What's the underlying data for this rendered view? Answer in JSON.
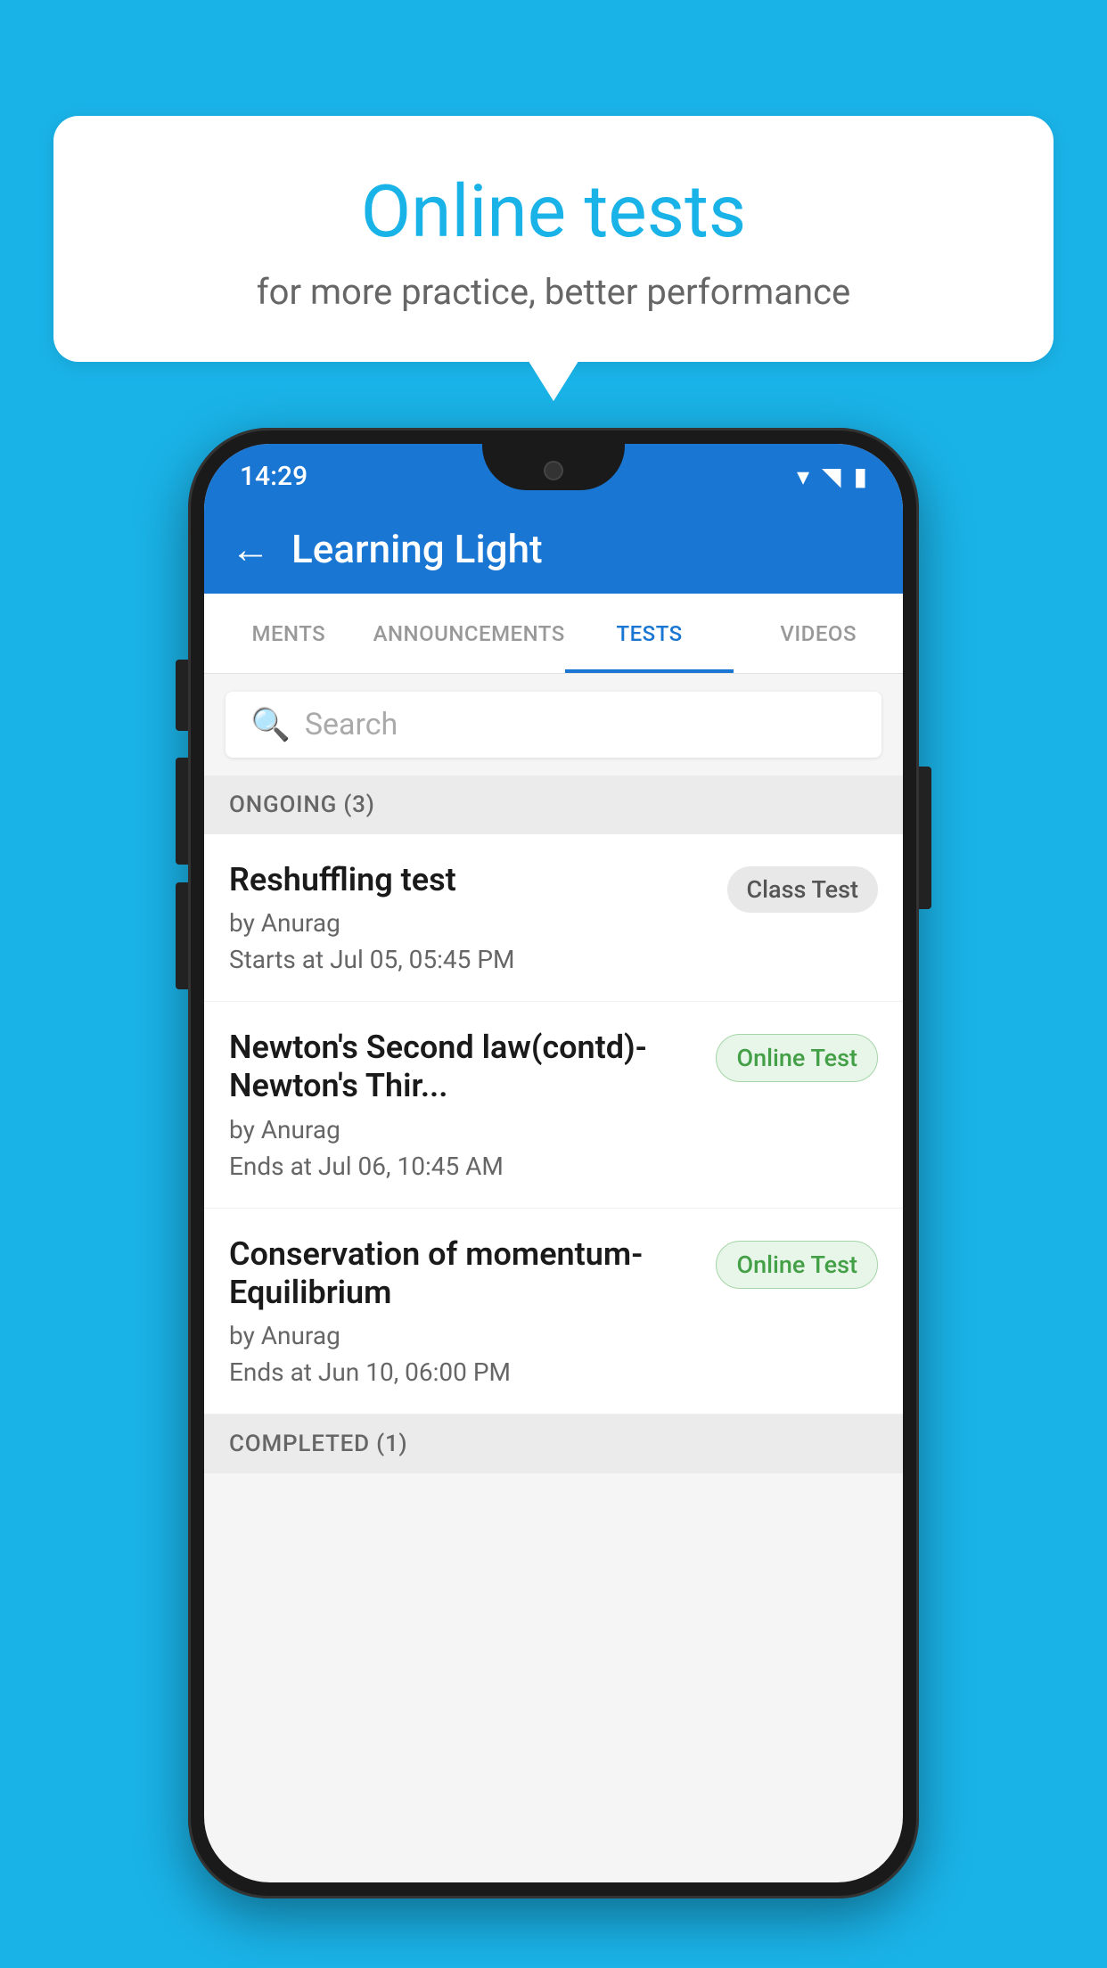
{
  "background_color": "#1ab3e8",
  "promo": {
    "title": "Online tests",
    "subtitle": "for more practice, better performance"
  },
  "phone": {
    "status_bar": {
      "time": "14:29"
    },
    "app_bar": {
      "title": "Learning Light",
      "back_label": "←"
    },
    "tabs": [
      {
        "label": "MENTS",
        "active": false
      },
      {
        "label": "ANNOUNCEMENTS",
        "active": false
      },
      {
        "label": "TESTS",
        "active": true
      },
      {
        "label": "VIDEOS",
        "active": false
      }
    ],
    "search": {
      "placeholder": "Search"
    },
    "ongoing_section": {
      "header": "ONGOING (3)",
      "tests": [
        {
          "title": "Reshuffling test",
          "author": "by Anurag",
          "time_label": "Starts at",
          "time_value": "Jul 05, 05:45 PM",
          "badge": "Class Test",
          "badge_type": "class"
        },
        {
          "title": "Newton's Second law(contd)-Newton's Thir...",
          "author": "by Anurag",
          "time_label": "Ends at",
          "time_value": "Jul 06, 10:45 AM",
          "badge": "Online Test",
          "badge_type": "online"
        },
        {
          "title": "Conservation of momentum-Equilibrium",
          "author": "by Anurag",
          "time_label": "Ends at",
          "time_value": "Jun 10, 06:00 PM",
          "badge": "Online Test",
          "badge_type": "online"
        }
      ]
    },
    "completed_section": {
      "header": "COMPLETED (1)"
    }
  }
}
